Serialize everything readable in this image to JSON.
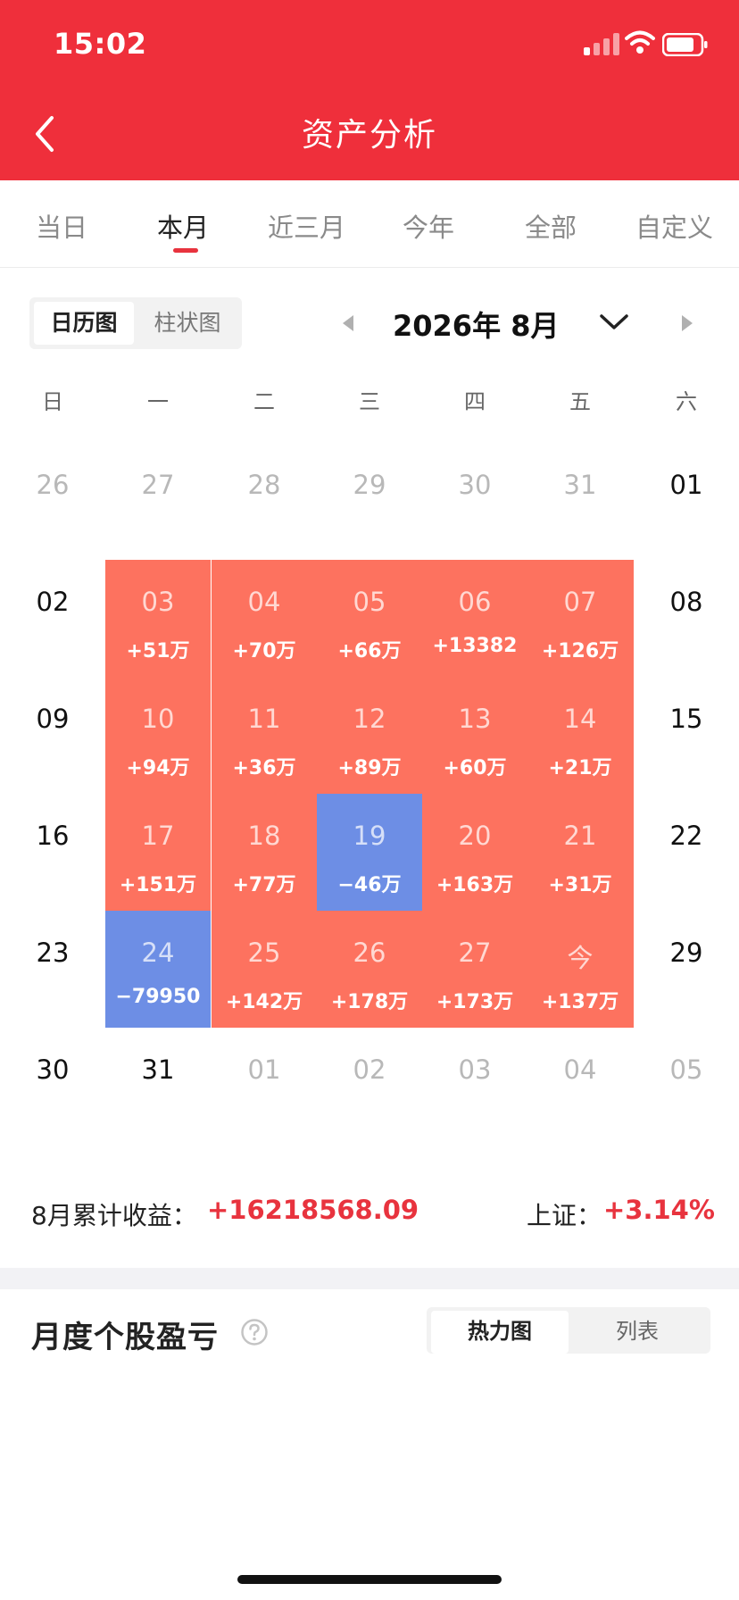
{
  "status_bar": {
    "time": "15:02"
  },
  "header": {
    "title": "资产分析",
    "back_icon": "chevron-left-icon"
  },
  "period_tabs": [
    {
      "label": "当日",
      "active": false
    },
    {
      "label": "本月",
      "active": true
    },
    {
      "label": "近三月",
      "active": false
    },
    {
      "label": "今年",
      "active": false
    },
    {
      "label": "全部",
      "active": false
    },
    {
      "label": "自定义",
      "active": false
    }
  ],
  "view_toggle": {
    "calendar": "日历图",
    "bar": "柱状图",
    "selected": "calendar"
  },
  "month_nav": {
    "label": "2026年 8月"
  },
  "weekdays": [
    "日",
    "一",
    "二",
    "三",
    "四",
    "五",
    "六"
  ],
  "calendar_weeks": [
    [
      {
        "day": "26",
        "other_month": true
      },
      {
        "day": "27",
        "other_month": true
      },
      {
        "day": "28",
        "other_month": true
      },
      {
        "day": "29",
        "other_month": true
      },
      {
        "day": "30",
        "other_month": true
      },
      {
        "day": "31",
        "other_month": true
      },
      {
        "day": "01"
      }
    ],
    [
      {
        "day": "02"
      },
      {
        "day": "03",
        "pnl": "+51万",
        "status": "profit"
      },
      {
        "day": "04",
        "pnl": "+70万",
        "status": "profit"
      },
      {
        "day": "05",
        "pnl": "+66万",
        "status": "profit"
      },
      {
        "day": "06",
        "pnl": "+13382",
        "status": "profit"
      },
      {
        "day": "07",
        "pnl": "+126万",
        "status": "profit"
      },
      {
        "day": "08"
      }
    ],
    [
      {
        "day": "09"
      },
      {
        "day": "10",
        "pnl": "+94万",
        "status": "profit"
      },
      {
        "day": "11",
        "pnl": "+36万",
        "status": "profit"
      },
      {
        "day": "12",
        "pnl": "+89万",
        "status": "profit"
      },
      {
        "day": "13",
        "pnl": "+60万",
        "status": "profit"
      },
      {
        "day": "14",
        "pnl": "+21万",
        "status": "profit"
      },
      {
        "day": "15"
      }
    ],
    [
      {
        "day": "16"
      },
      {
        "day": "17",
        "pnl": "+151万",
        "status": "profit"
      },
      {
        "day": "18",
        "pnl": "+77万",
        "status": "profit"
      },
      {
        "day": "19",
        "pnl": "−46万",
        "status": "loss"
      },
      {
        "day": "20",
        "pnl": "+163万",
        "status": "profit"
      },
      {
        "day": "21",
        "pnl": "+31万",
        "status": "profit"
      },
      {
        "day": "22"
      }
    ],
    [
      {
        "day": "23"
      },
      {
        "day": "24",
        "pnl": "−79950",
        "status": "loss"
      },
      {
        "day": "25",
        "pnl": "+142万",
        "status": "profit"
      },
      {
        "day": "26",
        "pnl": "+178万",
        "status": "profit"
      },
      {
        "day": "27",
        "pnl": "+173万",
        "status": "profit"
      },
      {
        "day": "今",
        "pnl": "+137万",
        "status": "profit"
      },
      {
        "day": "29"
      }
    ],
    [
      {
        "day": "30"
      },
      {
        "day": "31"
      },
      {
        "day": "01",
        "other_month": true
      },
      {
        "day": "02",
        "other_month": true
      },
      {
        "day": "03",
        "other_month": true
      },
      {
        "day": "04",
        "other_month": true
      },
      {
        "day": "05",
        "other_month": true
      }
    ]
  ],
  "summary": {
    "label": "8月累计收益：",
    "value": "+16218568.09",
    "index_label": "上证：",
    "index_value": "+3.14%"
  },
  "stock_section": {
    "title": "月度个股盈亏",
    "help_icon": "question-circle-icon",
    "toggle": {
      "heatmap": "热力图",
      "list": "列表",
      "selected": "heatmap"
    }
  },
  "colors": {
    "header": "#ef2f3b",
    "profit": "#fd725f",
    "loss": "#6d8ee5",
    "accent": "#e8333e"
  }
}
